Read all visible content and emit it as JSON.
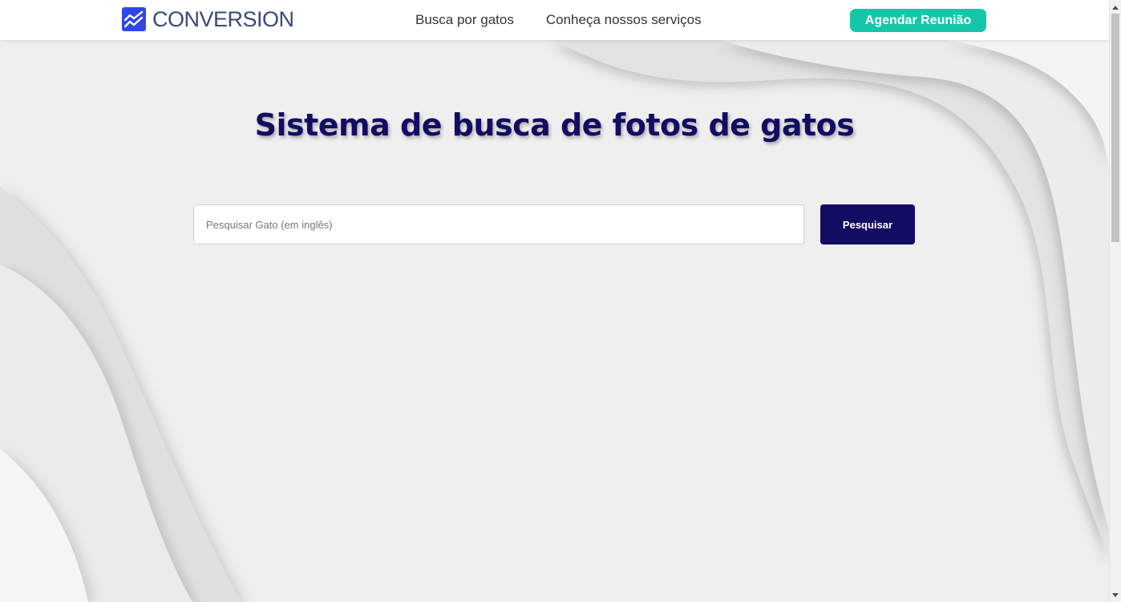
{
  "header": {
    "logo_text": "CONVERSION",
    "logo_icon": "trending-up-chart-icon",
    "nav": [
      {
        "label": "Busca por gatos"
      },
      {
        "label": "Conheça nossos serviços"
      }
    ],
    "cta_label": "Agendar Reunião"
  },
  "main": {
    "title": "Sistema de busca de fotos de gatos",
    "search": {
      "placeholder": "Pesquisar Gato (em inglês)",
      "value": "",
      "button_label": "Pesquisar"
    }
  },
  "colors": {
    "brand": "#2f47e6",
    "accent": "#16c6a8",
    "primary_dark": "#130c63",
    "background": "#efefef"
  }
}
